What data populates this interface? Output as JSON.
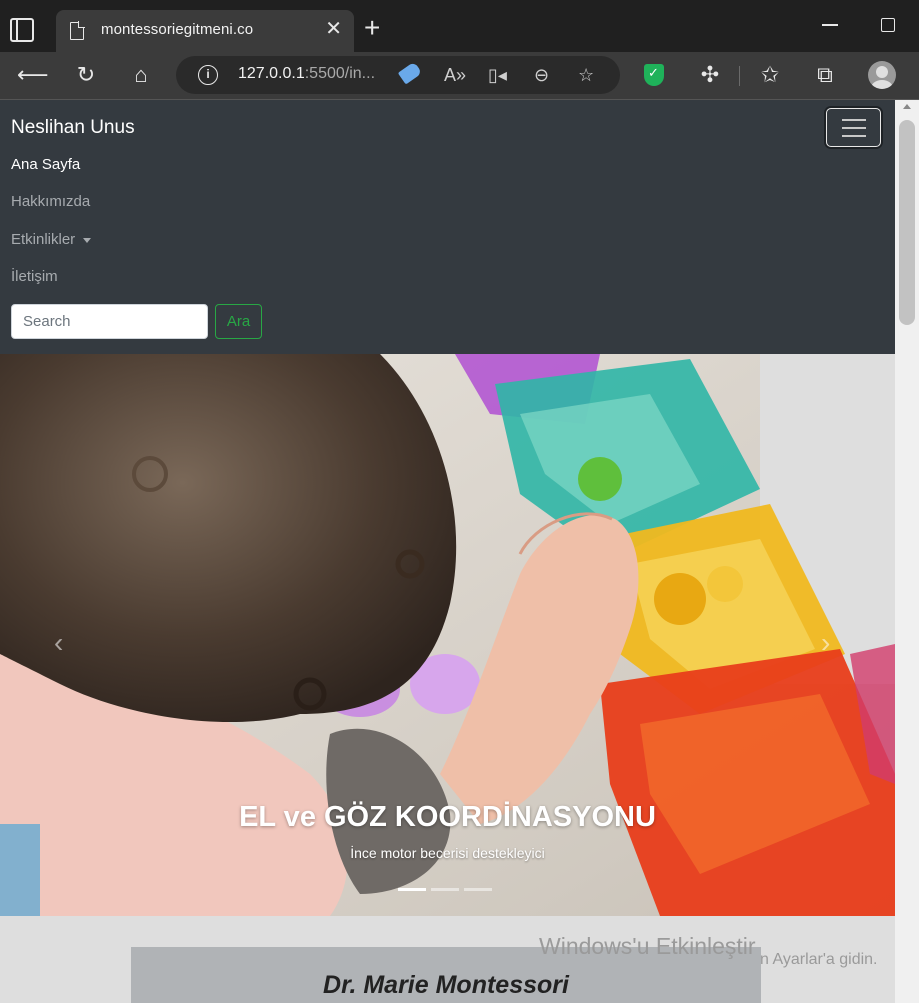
{
  "browser": {
    "tab_title": "montessoriegitmeni.co",
    "url_host": "127.0.0.1",
    "url_rest": ":5500/in..."
  },
  "navbar": {
    "brand": "Neslihan Unus",
    "links": [
      {
        "label": "Ana Sayfa"
      },
      {
        "label": "Hakkımızda"
      },
      {
        "label": "Etkinlikler"
      },
      {
        "label": "İletişim"
      }
    ],
    "search_placeholder": "Search",
    "search_button": "Ara"
  },
  "carousel": {
    "caption_title": "EL ve GÖZ KOORDİNASYONU",
    "caption_subtitle": "İnce motor becerisi destekleyici",
    "slide_count": 3,
    "active_slide": 1
  },
  "windows_watermark": {
    "line1": "Windows'u Etkinleştir",
    "line2": "n Ayarlar'a gidin."
  },
  "section": {
    "card_title": "Dr. Marie Montessori"
  }
}
